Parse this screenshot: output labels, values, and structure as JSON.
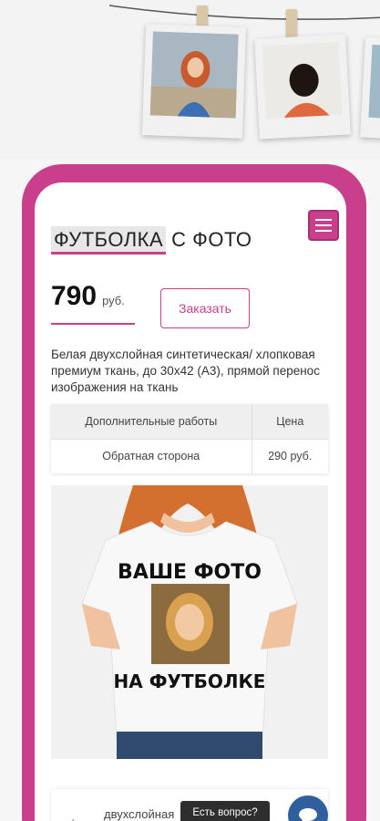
{
  "product": {
    "title_highlight": "ФУТБОЛКА",
    "title_rest": "С ФОТО",
    "price_value": "790",
    "price_currency": "руб.",
    "order_label": "Заказать",
    "description": "Белая двухслойная синтетическая/ хлопковая премиум ткань, до 30x42 (А3), прямой перенос изображения на ткань"
  },
  "table": {
    "headers": [
      "Дополнительные работы",
      "Цена"
    ],
    "rows": [
      [
        "Обратная сторона",
        "290 руб."
      ]
    ]
  },
  "shirt_print": {
    "line1": "ВАШЕ ФОТО",
    "line2": "НА ФУТБОЛКЕ"
  },
  "bottom_card": {
    "label": "двухслойная",
    "suffix": "/"
  },
  "chat": {
    "tooltip": "Есть вопрос?"
  },
  "colors": {
    "accent": "#c93f8c",
    "chat": "#2f5f9e"
  }
}
